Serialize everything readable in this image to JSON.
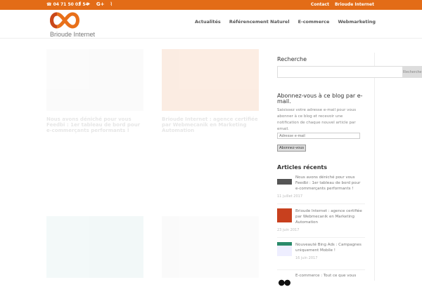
{
  "colors": {
    "accent": "#e36c17"
  },
  "topbar": {
    "phone": "☎ 04 71 50 03 54",
    "social": [
      {
        "icon": "facebook-icon",
        "glyph": "f"
      },
      {
        "icon": "twitter-icon",
        "glyph": "🐦"
      },
      {
        "icon": "google-plus-icon",
        "glyph": "G+"
      },
      {
        "icon": "rss-icon",
        "glyph": "◜"
      }
    ],
    "links": [
      "Contact",
      "Brioude Internet"
    ]
  },
  "header": {
    "logo_text": "Brioude Internet",
    "nav": [
      "Actualités",
      "Référencement Naturel",
      "E-commerce",
      "Webmarketing"
    ]
  },
  "main": {
    "cards": [
      {
        "title": "Nous avons déniché pour vous Feedbi : 1er tableau de bord pour e-commerçants performants !"
      },
      {
        "title": "Brioude Internet : agence certifiée par Webmecanik en Marketing Automation"
      }
    ]
  },
  "sidebar": {
    "search": {
      "title": "Recherche",
      "button": "Rechercher"
    },
    "subscribe": {
      "title": "Abonnez-vous à ce blog par e-mail.",
      "text": "Saisissez votre adresse e-mail pour vous abonner à ce blog et recevoir une notification de chaque nouvel article par email.",
      "placeholder": "Adresse e-mail",
      "button": "Abonnez-vous"
    },
    "recent": {
      "title": "Articles récents",
      "posts": [
        {
          "title": "Nous avons déniché pour vous Feedbi : 1er tableau de bord pour e-commerçants performants !",
          "date": "11 juillet 2017"
        },
        {
          "title": "Brioude Internet : agence certifiée par Webmecanik en Marketing Automation",
          "date": "23 juin 2017"
        },
        {
          "title": "Nouveauté Bing Ads : Campagnes uniquement Mobile !",
          "date": "16 juin 2017"
        },
        {
          "title": "E-commerce : Tout ce que vous"
        }
      ]
    }
  }
}
